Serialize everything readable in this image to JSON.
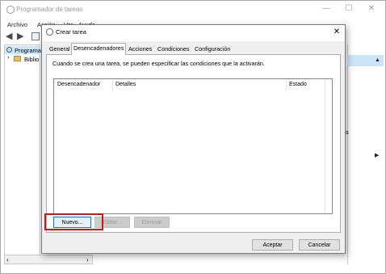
{
  "window": {
    "title": "Programador de tareas",
    "caption": {
      "minimize": "—",
      "maximize": "☐",
      "close": "✕"
    }
  },
  "menubar": {
    "items": [
      "Archivo",
      "Acción",
      "Ver",
      "Ayuda"
    ]
  },
  "tree": {
    "items": [
      {
        "label": "Programa",
        "selected": true
      },
      {
        "label": "Biblio",
        "selected": false
      }
    ]
  },
  "right_panel": {
    "fragment": "s"
  },
  "dialog": {
    "title": "Crear tarea",
    "close_glyph": "✕",
    "tabs": [
      {
        "label": "General",
        "active": false
      },
      {
        "label": "Desencadenadores",
        "active": true
      },
      {
        "label": "Acciones",
        "active": false
      },
      {
        "label": "Condiciones",
        "active": false
      },
      {
        "label": "Configuración",
        "active": false
      }
    ],
    "description": "Cuando se crea una tarea, se pueden especificar las condiciones que la activarán.",
    "list": {
      "columns": [
        "Desencadenador",
        "Detalles",
        "Estado"
      ],
      "rows": []
    },
    "buttons": {
      "new": "Nuevo...",
      "edit": "Editar...",
      "delete": "Eliminar",
      "accept": "Aceptar",
      "cancel": "Cancelar"
    }
  }
}
